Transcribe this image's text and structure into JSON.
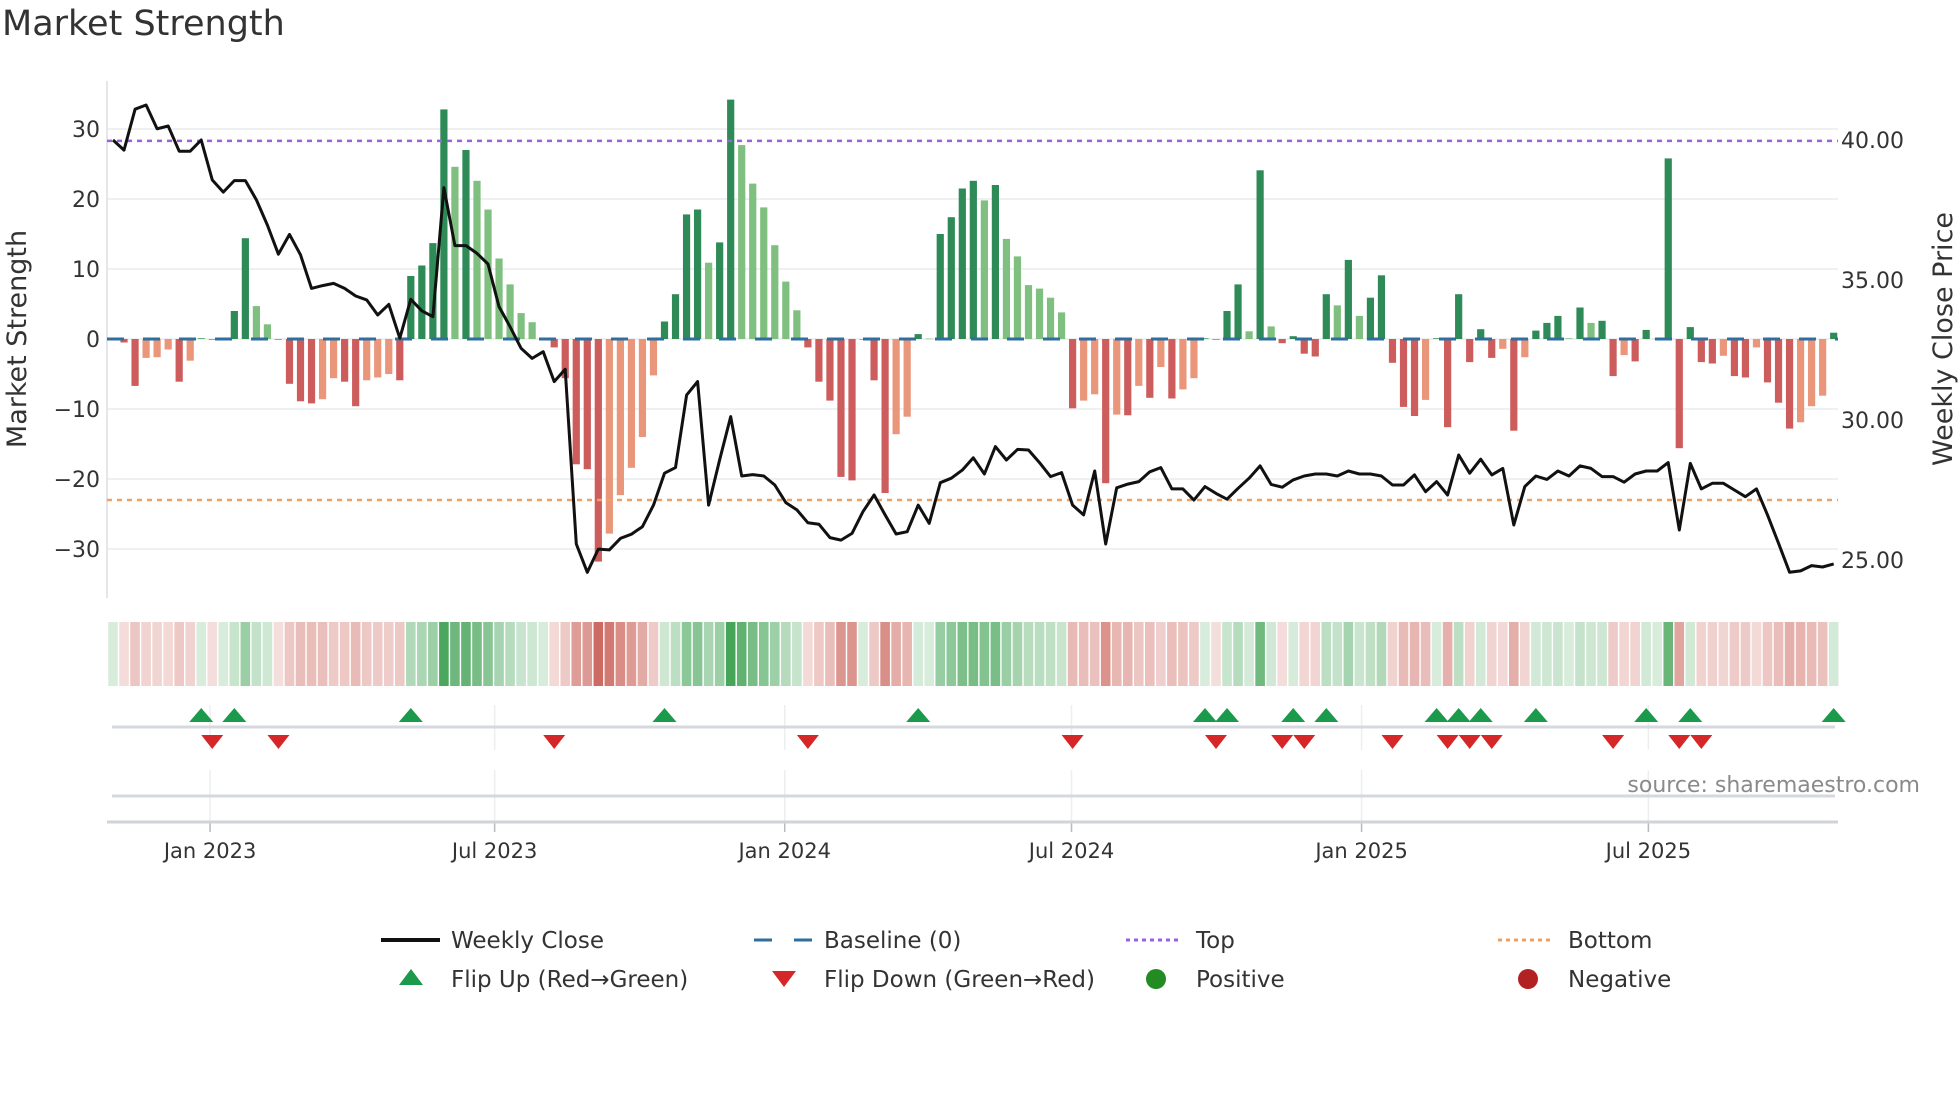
{
  "title": "Market Strength",
  "source": "source: sharemaestro.com",
  "legend": {
    "weekly_close": "Weekly Close",
    "baseline": "Baseline (0)",
    "top": "Top",
    "bottom": "Bottom",
    "flip_up": "Flip Up (Red→Green)",
    "flip_down": "Flip Down (Green→Red)",
    "positive": "Positive",
    "negative": "Negative"
  },
  "colors": {
    "strong_up": "#2e8b57",
    "weak_up": "#7fbf7f",
    "strong_down": "#cd5c5c",
    "weak_down": "#e9967a",
    "line": "#111111",
    "baseline": "#2f6f9f",
    "top": "#9b5fe0",
    "bottom": "#f0a060",
    "flip_up": "#1a9a4a",
    "flip_down": "#d62728",
    "positive": "#228b22",
    "negative": "#b22222"
  },
  "chart_data": {
    "type": "bar+line",
    "title": "Market Strength",
    "ylabel": "Market Strength",
    "y2label": "Weekly Close Price",
    "ylim": [
      -36,
      37
    ],
    "yticks": [
      "30",
      "20",
      "10",
      "0",
      "−10",
      "−20",
      "−30"
    ],
    "ytick_values": [
      30,
      20,
      10,
      0,
      -10,
      -20,
      -30
    ],
    "y2ticks": [
      "40.00",
      "35.00",
      "30.00",
      "25.00"
    ],
    "y2tick_values": [
      40,
      35,
      30,
      25
    ],
    "x_ticks": [
      {
        "label": "Jan 2023",
        "week": 8.8
      },
      {
        "label": "Jul 2023",
        "week": 34.6
      },
      {
        "label": "Jan 2024",
        "week": 60.9
      },
      {
        "label": "Jul 2024",
        "week": 86.9
      },
      {
        "label": "Jan 2025",
        "week": 113.2
      },
      {
        "label": "Jul 2025",
        "week": 139.2
      }
    ],
    "top_level": 28.3,
    "bottom_level": -23.0,
    "baseline": 0,
    "strength": [
      0,
      -0.5,
      -6.7,
      -2.7,
      -2.6,
      -1.5,
      -6.1,
      -3.1,
      0.1,
      -0.1,
      0,
      4,
      14.4,
      4.7,
      2.1,
      -0.1,
      -6.4,
      -8.9,
      -9.2,
      -8.6,
      -5.6,
      -6.1,
      -9.6,
      -5.9,
      -5.5,
      -5.0,
      -5.9,
      9.0,
      10.5,
      13.7,
      32.8,
      24.6,
      27,
      22.6,
      18.5,
      11.5,
      7.8,
      3.7,
      2.4,
      0.1,
      -1.2,
      -5.6,
      -17.9,
      -18.6,
      -31.8,
      -27.8,
      -22.3,
      -18.4,
      -14,
      -5.2,
      2.5,
      6.4,
      17.8,
      18.5,
      10.9,
      13.8,
      34.2,
      27.7,
      22.2,
      18.8,
      13.4,
      8.2,
      4.1,
      -1.2,
      -6.1,
      -8.8,
      -19.7,
      -20.2,
      0,
      -5.9,
      -22,
      -13.6,
      -11.1,
      0.7,
      0.05,
      15,
      17.4,
      21.5,
      22.6,
      19.8,
      22,
      14.3,
      11.8,
      7.7,
      7.2,
      5.9,
      3.8,
      -9.9,
      -8.8,
      -7.9,
      -20.6,
      -10.8,
      -10.9,
      -6.7,
      -8.4,
      -4,
      -8.5,
      -7.2,
      -5.6,
      0.1,
      -0.1,
      4,
      7.8,
      1.1,
      24.1,
      1.8,
      -0.6,
      0.4,
      -2.1,
      -2.5,
      6.4,
      4.8,
      11.3,
      3.3,
      5.9,
      9.1,
      -3.4,
      -9.7,
      -11,
      -8.7,
      0.1,
      -12.6,
      6.4,
      -3.3,
      1.4,
      -2.7,
      -1.4,
      -13.1,
      -2.6,
      1.2,
      2.3,
      3.3,
      0.1,
      4.5,
      2.3,
      2.6,
      -5.3,
      -2.3,
      -3.2,
      1.3,
      0.05,
      25.8,
      -15.6,
      1.7,
      -3.3,
      -3.5,
      -2.4,
      -5.3,
      -5.5,
      -1.2,
      -6.2,
      -9.1,
      -12.8,
      -11.9,
      -9.6,
      -8.1,
      0.9
    ],
    "weekly_close": [
      40.0,
      39.64,
      41.1,
      41.25,
      40.4,
      40.5,
      39.6,
      39.6,
      40.0,
      38.57,
      38.14,
      38.55,
      38.55,
      37.86,
      36.96,
      35.92,
      36.63,
      35.9,
      34.7,
      34.8,
      34.88,
      34.7,
      34.43,
      34.29,
      33.75,
      34.13,
      32.92,
      34.31,
      33.9,
      33.69,
      38.3,
      36.23,
      36.23,
      35.95,
      35.57,
      34.05,
      33.33,
      32.56,
      32.2,
      32.44,
      31.37,
      31.81,
      25.57,
      24.56,
      25.39,
      25.36,
      25.77,
      25.92,
      26.19,
      26.96,
      28.1,
      28.3,
      30.89,
      31.37,
      26.96,
      28.57,
      30.12,
      28.0,
      28.05,
      28.0,
      27.68,
      27.05,
      26.79,
      26.33,
      26.28,
      25.8,
      25.71,
      25.95,
      26.73,
      27.32,
      26.61,
      25.93,
      26.01,
      26.96,
      26.31,
      27.76,
      27.92,
      28.21,
      28.65,
      28.07,
      29.05,
      28.57,
      28.95,
      28.93,
      28.48,
      27.98,
      28.12,
      26.96,
      26.61,
      28.18,
      25.57,
      27.58,
      27.71,
      27.8,
      28.15,
      28.3,
      27.54,
      27.54,
      27.14,
      27.62,
      27.38,
      27.17,
      27.56,
      27.92,
      28.36,
      27.7,
      27.6,
      27.86,
      28.0,
      28.07,
      28.07,
      28.0,
      28.18,
      28.07,
      28.07,
      28.0,
      27.68,
      27.68,
      28.04,
      27.44,
      27.8,
      27.32,
      28.75,
      28.1,
      28.6,
      28.04,
      28.27,
      26.25,
      27.62,
      28.0,
      27.88,
      28.18,
      28.0,
      28.36,
      28.27,
      27.98,
      27.98,
      27.78,
      28.07,
      28.18,
      28.18,
      28.48,
      26.07,
      28.45,
      27.54,
      27.74,
      27.74,
      27.5,
      27.26,
      27.54,
      26.61,
      25.6,
      24.56,
      24.61,
      24.8,
      24.75,
      24.86
    ],
    "legend_position": "bottom"
  }
}
